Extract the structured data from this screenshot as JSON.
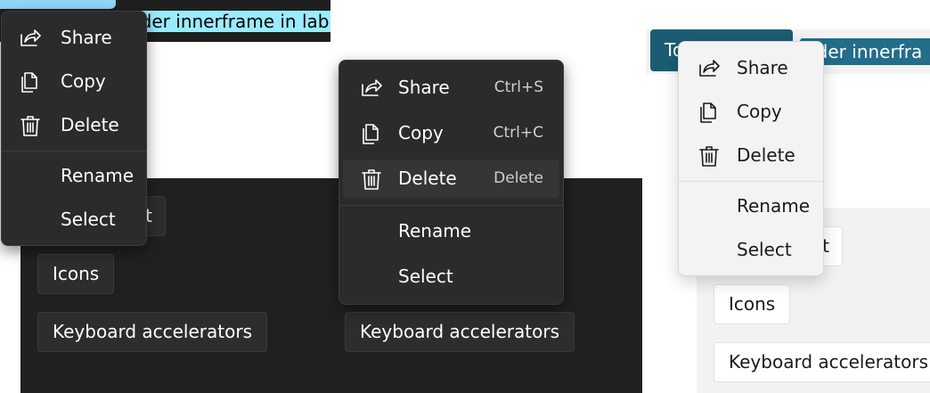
{
  "panel_left": {
    "label_text": "nder innerframe in lab",
    "background_buttons": {
      "partial_label": "t",
      "icons_label": "Icons",
      "keyboard_label": "Keyboard accelerators"
    },
    "menu": {
      "items": [
        {
          "label": "Share",
          "icon": "share-icon"
        },
        {
          "label": "Copy",
          "icon": "copy-icon"
        },
        {
          "label": "Delete",
          "icon": "delete-icon"
        },
        {
          "label": "Rename"
        },
        {
          "label": "Select"
        }
      ]
    }
  },
  "panel_middle": {
    "background_buttons": {
      "keyboard_label": "Keyboard accelerators"
    },
    "menu": {
      "items": [
        {
          "label": "Share",
          "icon": "share-icon",
          "accelerator": "Ctrl+S"
        },
        {
          "label": "Copy",
          "icon": "copy-icon",
          "accelerator": "Ctrl+C"
        },
        {
          "label": "Delete",
          "icon": "delete-icon",
          "accelerator": "Delete"
        },
        {
          "label": "Rename"
        },
        {
          "label": "Select"
        }
      ]
    }
  },
  "panel_right": {
    "accent_button_text": "To",
    "label_text": "nder innerfra",
    "background_buttons": {
      "partial_label": "t",
      "icons_label": "Icons",
      "keyboard_label": "Keyboard accelerators"
    },
    "menu": {
      "items": [
        {
          "label": "Share",
          "icon": "share-icon"
        },
        {
          "label": "Copy",
          "icon": "copy-icon"
        },
        {
          "label": "Delete",
          "icon": "delete-icon"
        },
        {
          "label": "Rename"
        },
        {
          "label": "Select"
        }
      ]
    }
  },
  "colors": {
    "dark_background": "#202020",
    "dark_menu": "#2b2b2b",
    "light_background": "#f2f2f2",
    "light_menu": "#f3f3f3",
    "accent_light_blue": "#99ebff",
    "accent_teal": "#1c5c73"
  }
}
